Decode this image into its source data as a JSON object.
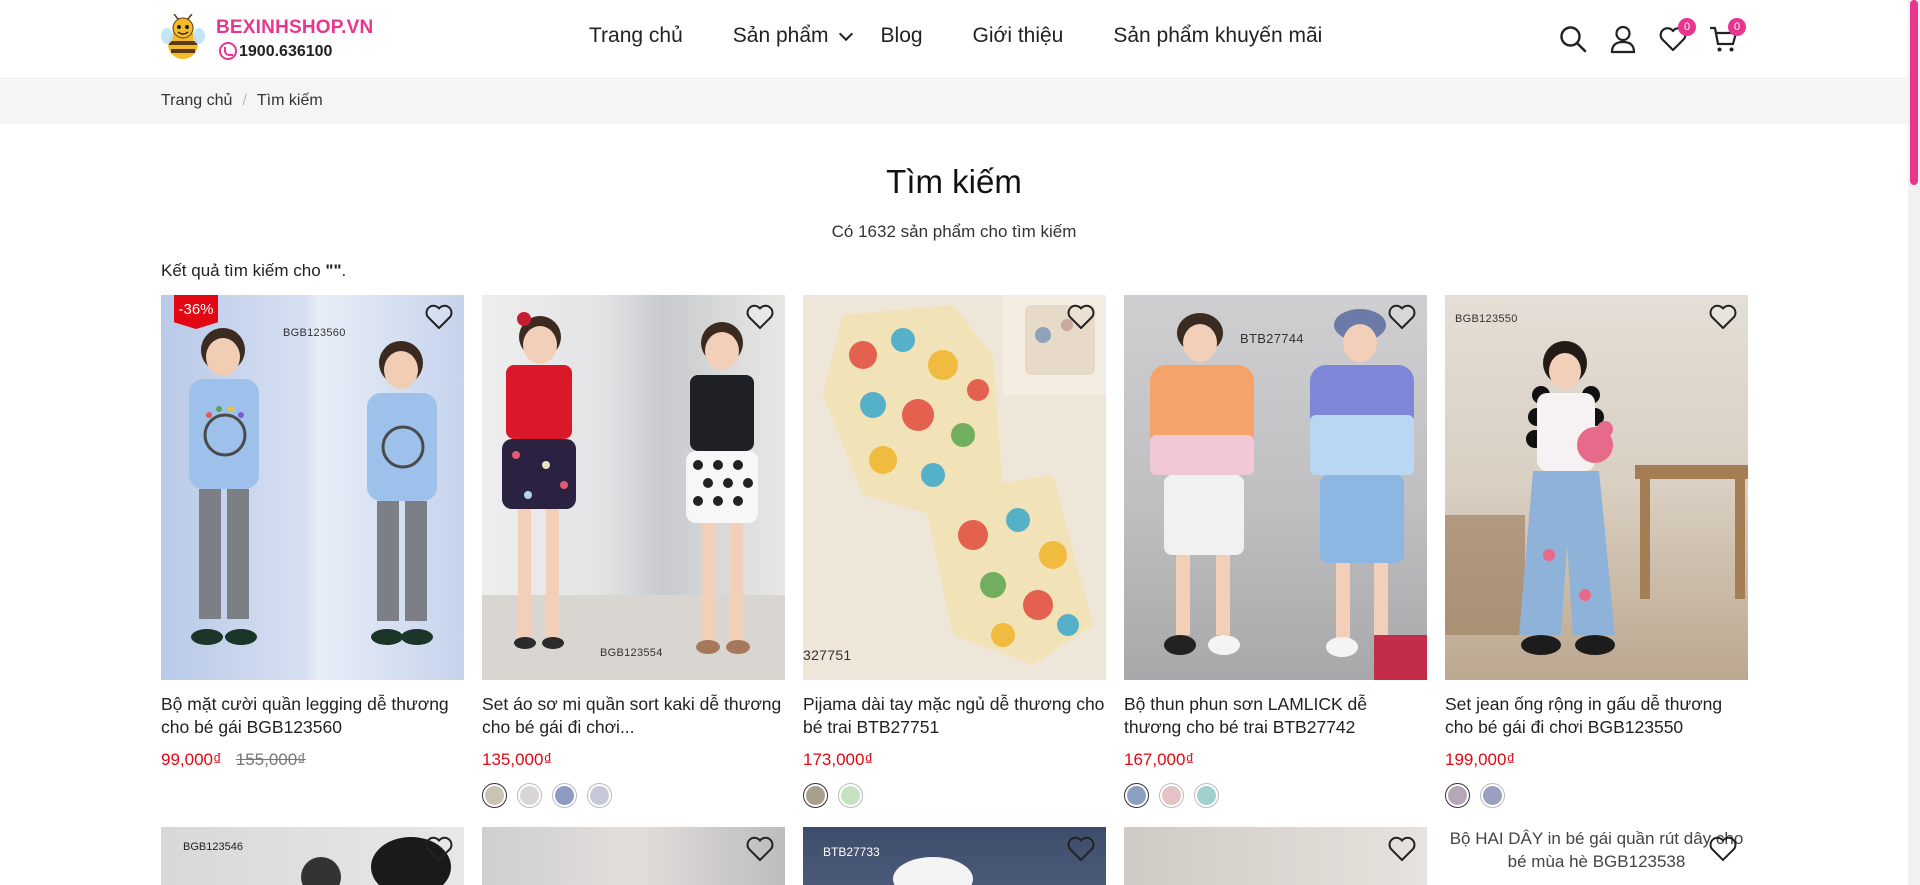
{
  "header": {
    "brand": "BEXINHSHOP.VN",
    "phone": "1900.636100",
    "nav": [
      "Trang chủ",
      "Sản phẩm",
      "Blog",
      "Giới thiệu",
      "Sản phẩm khuyến mãi"
    ],
    "wishlist_count": "0",
    "cart_count": "0",
    "accent": "#e8368f"
  },
  "breadcrumb": {
    "home": "Trang chủ",
    "sep": "/",
    "current": "Tìm kiếm"
  },
  "main": {
    "title": "Tìm kiếm",
    "count_text": "Có 1632 sản phẩm cho tìm kiếm",
    "result_prefix": "Kết quả tìm kiếm cho ",
    "result_query": "\"\"",
    "result_suffix": "."
  },
  "products": [
    {
      "name": "Bộ mặt cười quần legging dễ thương cho bé gái BGB123560",
      "price": "99,000₫",
      "old_price": "155,000₫",
      "sale": "-36%",
      "code": "BGB123560",
      "swatches": []
    },
    {
      "name": "Set áo sơ mi quần sort kaki dễ thương cho bé gái đi chơi...",
      "price": "135,000₫",
      "code": "BGB123554",
      "swatches": [
        "#c9c2b5",
        "#d9d5d5",
        "#8e9bc1",
        "#c8c9d8"
      ]
    },
    {
      "name": "Pijama dài tay mặc ngủ dễ thương cho bé trai BTB27751",
      "price": "173,000₫",
      "code": "327751",
      "swatches": [
        "#a89f8e",
        "#c5e2c2"
      ]
    },
    {
      "name": "Bộ thun phun sơn LAMLICK dễ thương cho bé trai BTB27742",
      "price": "167,000₫",
      "code": "BTB27744",
      "swatches": [
        "#8d9fc0",
        "#e3c3c5",
        "#9fd1cf"
      ]
    },
    {
      "name": "Set jean ống rộng in gấu dễ thương cho bé gái đi chơi BGB123550",
      "price": "199,000₫",
      "code": "BGB123550",
      "swatches": [
        "#b6a7b6",
        "#9aa1c0"
      ]
    }
  ],
  "row2": {
    "code1": "BGB123546",
    "code3": "BTB27733",
    "alt5": "Bộ HAI DÂY in bé gái quần rút dây cho bé mùa hè BGB123538"
  },
  "icons": {
    "search": "search-icon",
    "user": "user-icon",
    "heart": "heart-icon",
    "cart": "cart-icon"
  }
}
